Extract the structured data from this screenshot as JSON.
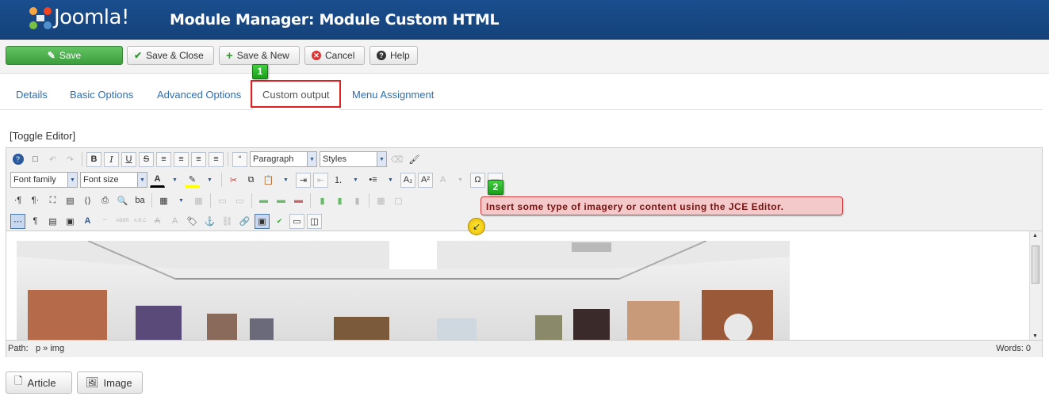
{
  "header": {
    "logo_text": "Joomla!",
    "title": "Module Manager: Module Custom HTML"
  },
  "toolbar": {
    "save": "Save",
    "save_close": "Save & Close",
    "save_new": "Save & New",
    "cancel": "Cancel",
    "help": "Help"
  },
  "tabs": [
    "Details",
    "Basic Options",
    "Advanced Options",
    "Custom output",
    "Menu Assignment"
  ],
  "active_tab": "Custom output",
  "steps": [
    "1",
    "2"
  ],
  "toggle_editor": "[Toggle Editor]",
  "editor": {
    "format_select": "Paragraph",
    "styles_select": "Styles",
    "font_family": "Font family",
    "font_size": "Font size",
    "path_label": "Path:",
    "path_value": "p » img",
    "words": "Words: 0"
  },
  "callout": "Insert some type of imagery or content using the JCE Editor.",
  "bottom_buttons": {
    "article": "Article",
    "image": "Image"
  },
  "colors": {
    "header_bg": "#1a4e8e",
    "save_green": "#4cb34c",
    "highlight_red": "#e02020",
    "badge_green": "#2db82d",
    "link_blue": "#2a70b8"
  }
}
